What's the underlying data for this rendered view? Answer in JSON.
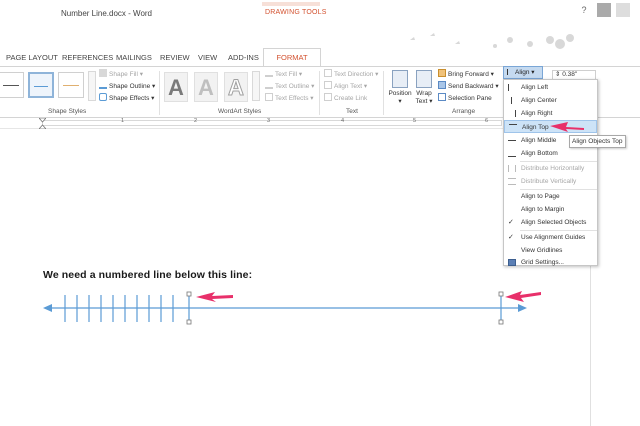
{
  "window": {
    "title": "Number Line.docx - Word",
    "contextual_group": "DRAWING TOOLS",
    "help_label": "?"
  },
  "tabs": [
    "PAGE LAYOUT",
    "REFERENCES",
    "MAILINGS",
    "REVIEW",
    "VIEW",
    "ADD-INS"
  ],
  "active_tab": "FORMAT",
  "ribbon": {
    "shape_styles": {
      "label": "Shape Styles",
      "fill": "Shape Fill",
      "outline": "Shape Outline",
      "effects": "Shape Effects"
    },
    "wordart": {
      "label": "WordArt Styles",
      "letters": [
        "A",
        "A",
        "A"
      ],
      "text_fill": "Text Fill",
      "text_outline": "Text Outline",
      "text_effects": "Text Effects"
    },
    "text": {
      "label": "Text",
      "direction": "Text Direction",
      "align": "Align Text",
      "link": "Create Link"
    },
    "arrange": {
      "label": "Arrange",
      "position": "Position",
      "wrap_line1": "Wrap",
      "wrap_line2": "Text",
      "bring_forward": "Bring Forward",
      "send_backward": "Send Backward",
      "selection_pane": "Selection Pane",
      "align": "Align",
      "size_value": "0.38\""
    }
  },
  "ruler_numbers": [
    "1",
    "2",
    "3",
    "4",
    "5",
    "6"
  ],
  "document": {
    "line_text": "We need a numbered line below this line:"
  },
  "align_menu": {
    "items": [
      {
        "label": "Align Left",
        "enabled": true
      },
      {
        "label": "Align Center",
        "enabled": true
      },
      {
        "label": "Align Right",
        "enabled": true
      },
      {
        "label": "Align Top",
        "enabled": true,
        "highlighted": true
      },
      {
        "label": "Align Middle",
        "enabled": true
      },
      {
        "label": "Align Bottom",
        "enabled": true
      },
      {
        "label": "Distribute Horizontally",
        "enabled": false
      },
      {
        "label": "Distribute Vertically",
        "enabled": false
      },
      {
        "label": "Align to Page",
        "enabled": true
      },
      {
        "label": "Align to Margin",
        "enabled": true
      },
      {
        "label": "Align Selected Objects",
        "enabled": true,
        "checked": true
      },
      {
        "label": "Use Alignment Guides",
        "enabled": true,
        "checked": true
      },
      {
        "label": "View Gridlines",
        "enabled": true
      },
      {
        "label": "Grid Settings...",
        "enabled": true
      }
    ],
    "tooltip": "Align Objects Top"
  },
  "colors": {
    "accent_orange": "#d35230",
    "line_blue": "#5b9bd5",
    "arrow_pink": "#e8306a",
    "menu_highlight": "#cde3f7"
  }
}
